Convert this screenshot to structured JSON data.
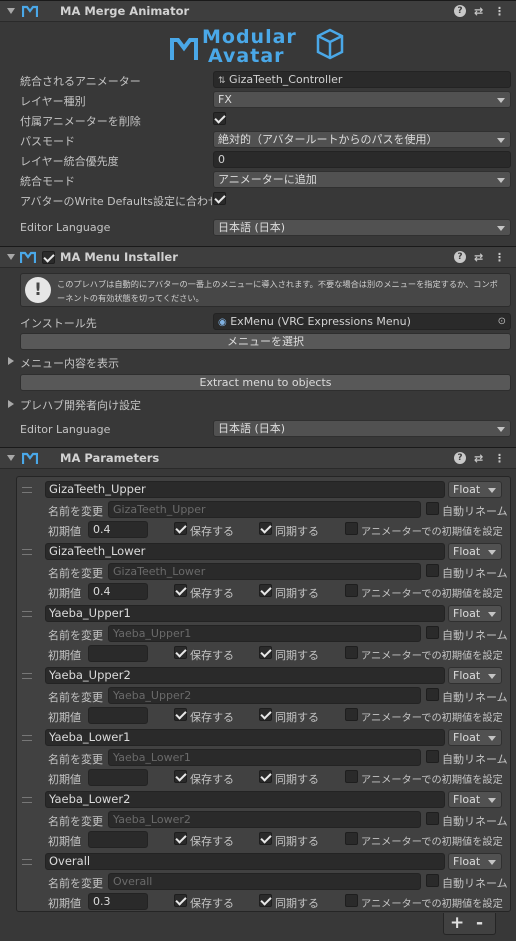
{
  "merge_animator": {
    "title": "MA Merge Animator",
    "logo_line1": "Modular",
    "logo_line2": "Avatar",
    "fields": [
      {
        "label": "統合されるアニメーター",
        "value": "GizaTeeth_Controller",
        "kind": "object"
      },
      {
        "label": "レイヤー種別",
        "value": "FX",
        "kind": "dropdown"
      },
      {
        "label": "付属アニメーターを削除",
        "kind": "check",
        "checked": true
      },
      {
        "label": "パスモード",
        "value": "絶対的（アバタールートからのパスを使用）",
        "kind": "dropdown"
      },
      {
        "label": "レイヤー統合優先度",
        "value": "0",
        "kind": "text"
      },
      {
        "label": "統合モード",
        "value": "アニメーターに追加",
        "kind": "dropdown"
      },
      {
        "label": "アバターのWrite Defaults設定に合わせ",
        "kind": "check",
        "checked": true
      }
    ],
    "editor_language_label": "Editor Language",
    "editor_language_value": "日本語 (日本)"
  },
  "menu_installer": {
    "title": "MA Menu Installer",
    "info_text_1": "このプレハブは自動的にアバターの一番上のメニューに導入されます。不要な場合は別のメニューを指定するか、コンポ",
    "info_text_2": "ーネントの有効状態を切ってください。",
    "install_label": "インストール先",
    "install_value": "ExMenu (VRC Expressions Menu)",
    "select_menu_button": "メニューを選択",
    "show_contents_label": "メニュー内容を表示",
    "extract_button": "Extract menu to objects",
    "prefab_dev_label": "プレハブ開発者向け設定",
    "editor_language_label": "Editor Language",
    "editor_language_value": "日本語 (日本)"
  },
  "parameters": {
    "title": "MA Parameters",
    "rename_label": "名前を変更",
    "auto_rename_label": "自動リネーム",
    "initial_label": "初期値",
    "save_label": "保存する",
    "sync_label": "同期する",
    "anim_default_label": "アニメーターでの初期値を設定",
    "items": [
      {
        "name": "GizaTeeth_Upper",
        "type": "Float",
        "rename_placeholder": "GizaTeeth_Upper",
        "initial": "0.4",
        "save": true,
        "sync": true
      },
      {
        "name": "GizaTeeth_Lower",
        "type": "Float",
        "rename_placeholder": "GizaTeeth_Lower",
        "initial": "0.4",
        "save": true,
        "sync": true
      },
      {
        "name": "Yaeba_Upper1",
        "type": "Float",
        "rename_placeholder": "Yaeba_Upper1",
        "initial": "",
        "save": true,
        "sync": true
      },
      {
        "name": "Yaeba_Upper2",
        "type": "Float",
        "rename_placeholder": "Yaeba_Upper2",
        "initial": "",
        "save": true,
        "sync": true
      },
      {
        "name": "Yaeba_Lower1",
        "type": "Float",
        "rename_placeholder": "Yaeba_Lower1",
        "initial": "",
        "save": true,
        "sync": true
      },
      {
        "name": "Yaeba_Lower2",
        "type": "Float",
        "rename_placeholder": "Yaeba_Lower2",
        "initial": "",
        "save": true,
        "sync": true
      },
      {
        "name": "Overall",
        "type": "Float",
        "rename_placeholder": "Overall",
        "initial": "0.3",
        "save": true,
        "sync": true
      }
    ],
    "add_button": "+",
    "remove_button": "-"
  },
  "colors": {
    "panel_bg": "#383838",
    "header_bg": "#3e3e3e",
    "field_bg": "#2a2a2a",
    "accent_blue": "#4aa8e8"
  }
}
